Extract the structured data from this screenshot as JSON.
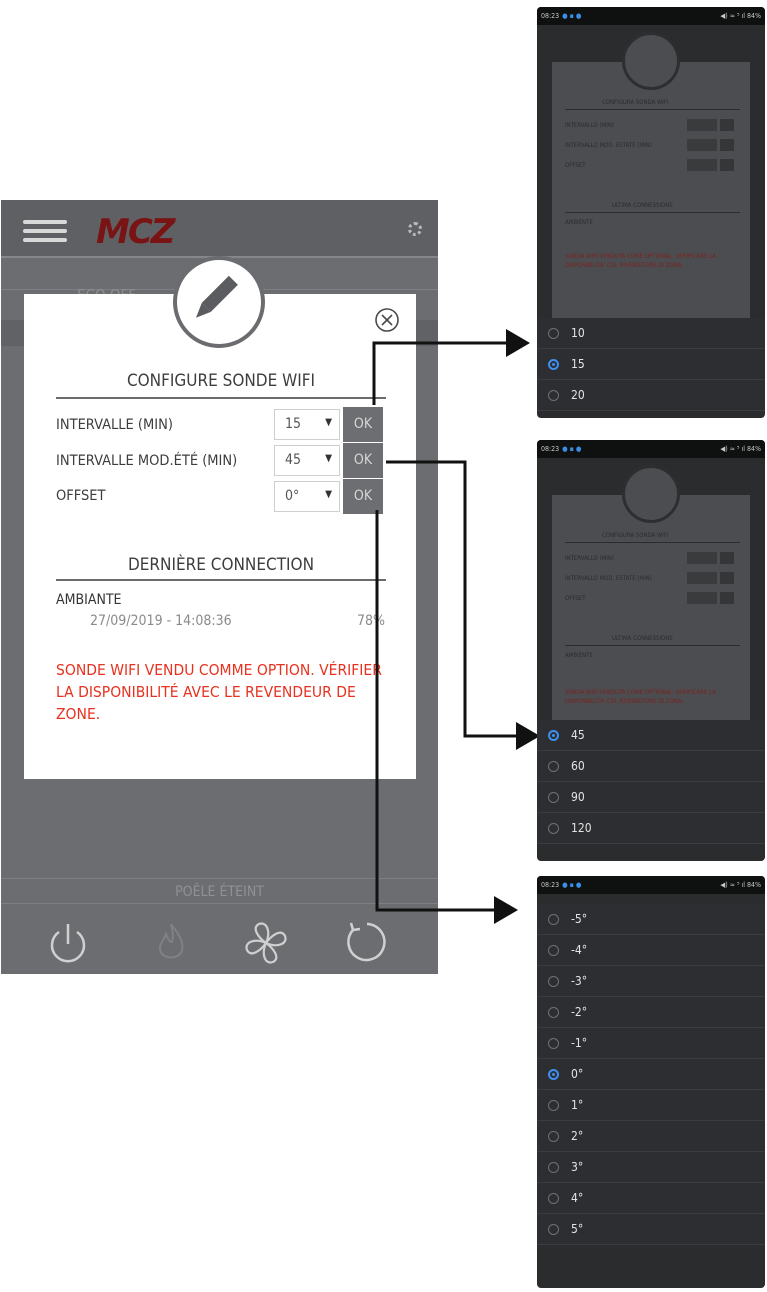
{
  "main": {
    "bg_mode": "ECO OFF",
    "status": "POÊLE ÉTEINT",
    "dialog": {
      "title": "CONFIGURE SONDE WIFI",
      "rows": [
        {
          "label": "INTERVALLE (MIN)",
          "value": "15",
          "ok": "OK"
        },
        {
          "label": "INTERVALLE MOD.ÉTÉ (MIN)",
          "value": "45",
          "ok": "OK"
        },
        {
          "label": "OFFSET",
          "value": "0°",
          "ok": "OK"
        }
      ],
      "section_title": "DERNIÈRE CONNECTION",
      "ambiante_label": "AMBIANTE",
      "ambiante_date": "27/09/2019 - 14:08:36",
      "ambiante_pct": "78%",
      "warning": "SONDE WIFI VENDU COMME OPTION. VÉRIFIER LA DISPONIBILITÉ AVEC LE REVENDEUR DE ZONE."
    }
  },
  "phones": {
    "status_time": "08:23",
    "status_right": "◀) ≈ ⁵ ıl 84%",
    "p1_options": [
      "10",
      "15",
      "20"
    ],
    "p1_selected": "15",
    "p2_options": [
      "45",
      "60",
      "90",
      "120"
    ],
    "p2_selected": "45",
    "p3_options": [
      "-5°",
      "-4°",
      "-3°",
      "-2°",
      "-1°",
      "0°",
      "1°",
      "2°",
      "3°",
      "4°",
      "5°"
    ],
    "p3_selected": "0°",
    "mini": {
      "title": "CONFIGURA SONDA WIFI",
      "r1": "INTERVALLO (MIN)",
      "r2": "INTERVALLO MOD. ESTATE (MIN)",
      "r3": "OFFSET",
      "last": "ULTIMA CONNESSIONE",
      "amb": "AMBIENTE",
      "red": "SONDA WIFI VENDUTA COME OPTIONAL. VERIFICARE LA DISPONIBILITA' COL RIVENDITORE DI ZONA."
    }
  },
  "colors": {
    "accent_blue": "#3d8ff0",
    "warning_red": "#e8311f",
    "ok_button": "#6c6e71"
  }
}
